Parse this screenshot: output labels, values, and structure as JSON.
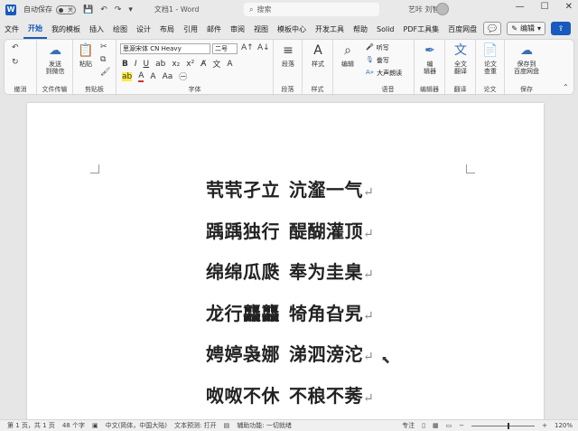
{
  "titlebar": {
    "autosave_label": "自动保存",
    "autosave_state": "关",
    "doc_title": "文档1 - Word",
    "search_placeholder": "搜索",
    "user_name": "艺咔 刘智",
    "icons": [
      "word-logo",
      "save-icon",
      "undo-icon",
      "redo-icon",
      "customize-icon"
    ]
  },
  "menu": {
    "tabs": [
      "文件",
      "开始",
      "我的模板",
      "插入",
      "绘图",
      "设计",
      "布局",
      "引用",
      "邮件",
      "审阅",
      "视图",
      "模板中心",
      "开发工具",
      "帮助",
      "Solid",
      "PDF工具集",
      "百度网盘"
    ],
    "active": "开始",
    "edit_label": "编辑",
    "comment_icon": "comment-icon",
    "share_icon": "share-icon"
  },
  "ribbon": {
    "groups": {
      "undo": "撤消",
      "file_transfer": "文件传输",
      "clipboard": "剪贴板",
      "font": "字体",
      "paragraph": "段落",
      "style": "样式",
      "voice": "语音",
      "editor": "编辑器",
      "translate": "翻译",
      "paper": "论文",
      "save": "保存"
    },
    "buttons": {
      "send_wechat": "发送\n到微信",
      "paste": "粘贴",
      "paragraph": "段落",
      "style": "样式",
      "edit": "编辑",
      "dictate": "听写",
      "read_aloud": "誊写",
      "read_loud": "大声朗读",
      "editor": "编\n辑器",
      "full_translate": "全文\n翻译",
      "paper_check": "论文\n查重",
      "save_baidu": "保存到\n百度网盘"
    },
    "font_name": "思源宋体 CN Heavy",
    "font_size": "二号"
  },
  "document": {
    "lines": [
      {
        "a": "茕茕孑立",
        "b": "沆瀣一气"
      },
      {
        "a": "踽踽独行",
        "b": "醍醐灌顶"
      },
      {
        "a": "绵绵瓜瓞",
        "b": "奉为圭臬"
      },
      {
        "a": "龙行龘龘",
        "b": "犄角旮旯"
      },
      {
        "a": "娉婷袅娜",
        "b": "涕泗滂沱"
      },
      {
        "a": "呶呶不休",
        "b": "不稂不莠"
      }
    ],
    "para_mark": "↵"
  },
  "status": {
    "page": "第 1 页，共 1 页",
    "words": "48 个字",
    "language": "中文(简体，中国大陆)",
    "predict": "文本预测: 打开",
    "accessibility": "辅助功能: 一切就绪",
    "focus": "专注",
    "zoom": "120%"
  }
}
